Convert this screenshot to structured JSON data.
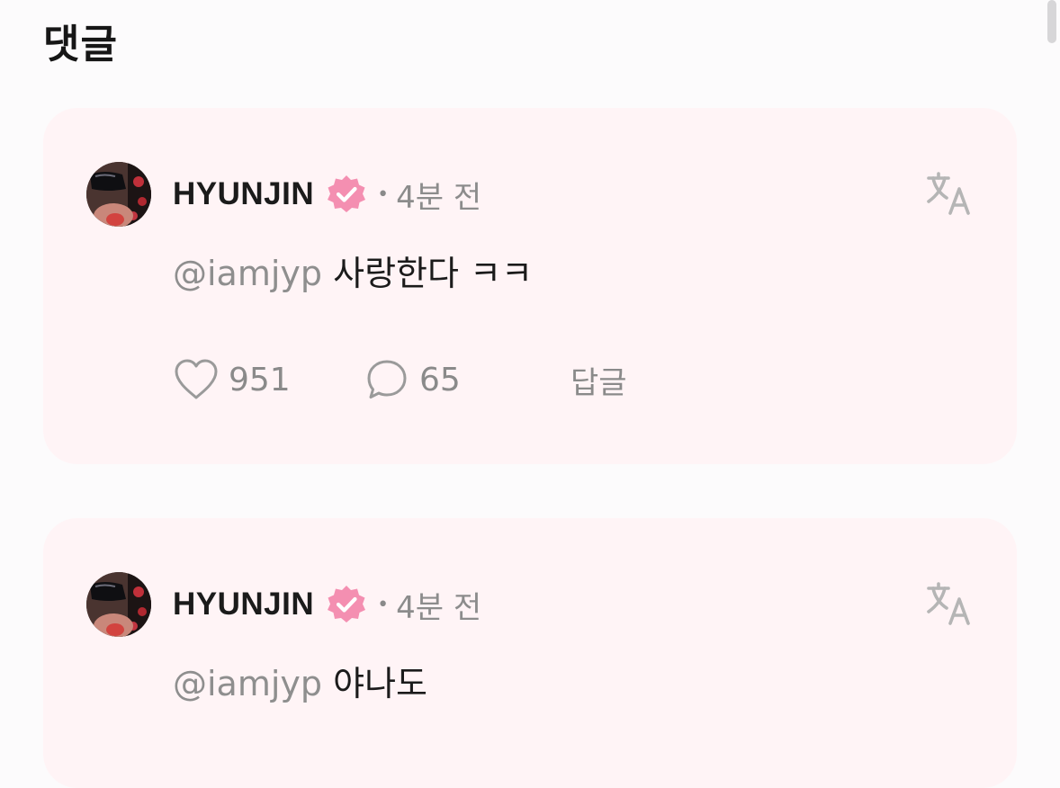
{
  "page": {
    "title": "댓글"
  },
  "colors": {
    "card_bg": "#fff4f6",
    "badge_pink": "#f48fb1",
    "muted_text": "#8a8a8a"
  },
  "comments": [
    {
      "author": "HYUNJIN",
      "verified": true,
      "time": "4분 전",
      "mention": "@iamjyp",
      "text": "사랑한다 ㅋㅋ",
      "likes": "951",
      "replies": "65",
      "reply_label": "답글",
      "icons": [
        "heart-icon",
        "speech-bubble-icon",
        "translate-icon",
        "verified-badge-icon"
      ]
    },
    {
      "author": "HYUNJIN",
      "verified": true,
      "time": "4분 전",
      "mention": "@iamjyp",
      "text": "야나도",
      "icons": [
        "translate-icon",
        "verified-badge-icon"
      ]
    }
  ]
}
